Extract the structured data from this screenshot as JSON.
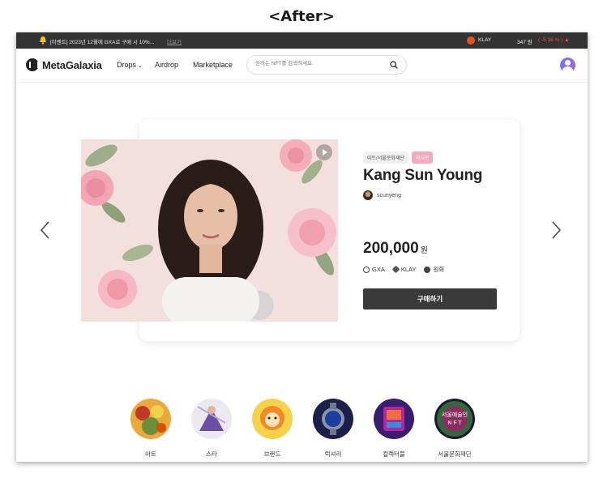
{
  "caption": "<After>",
  "topbar": {
    "event_text": "[이벤트] 2023년 12월에 GXA로 구매 시 10%...",
    "more_link": "더보기",
    "klay_label": "KLAY",
    "klay_price": "347 원",
    "klay_change": "( -5.16 % ) ▲",
    "icons": [
      "bell-icon",
      "klay-logo-icon"
    ]
  },
  "nav": {
    "logo_text": "MetaGalaxia",
    "menu": {
      "drops": "Drops",
      "airdrop": "Airdrop",
      "marketplace": "Marketplace"
    },
    "search_placeholder": "원하는 NFT를 검색하세요.",
    "icons": [
      "search-icon",
      "user-avatar-icon",
      "chevron-down-icon"
    ]
  },
  "featured": {
    "category_tag": "아트/서울문화재단",
    "edition_tag": "에디션",
    "title": "Kang Sun Young",
    "creator": "scunyeng",
    "price": "200,000",
    "currency_unit": "원",
    "payment_methods": [
      "GXA",
      "KLAY",
      "원화"
    ],
    "buy_label": "구매하기"
  },
  "categories": [
    "아트",
    "스타",
    "브랜드",
    "럭셔리",
    "컬렉터블",
    "서울문화재단"
  ],
  "category_badge_text": {
    "line1": "서울예술인",
    "line2": "N F T"
  },
  "colors": {
    "topbar_bg": "#333333",
    "buy_button": "#3a3a3a",
    "edition_tag": "#f7a8be",
    "change_red": "#ff4d4d",
    "avatar_gradient": [
      "#6a7bff",
      "#b55bd8"
    ]
  }
}
